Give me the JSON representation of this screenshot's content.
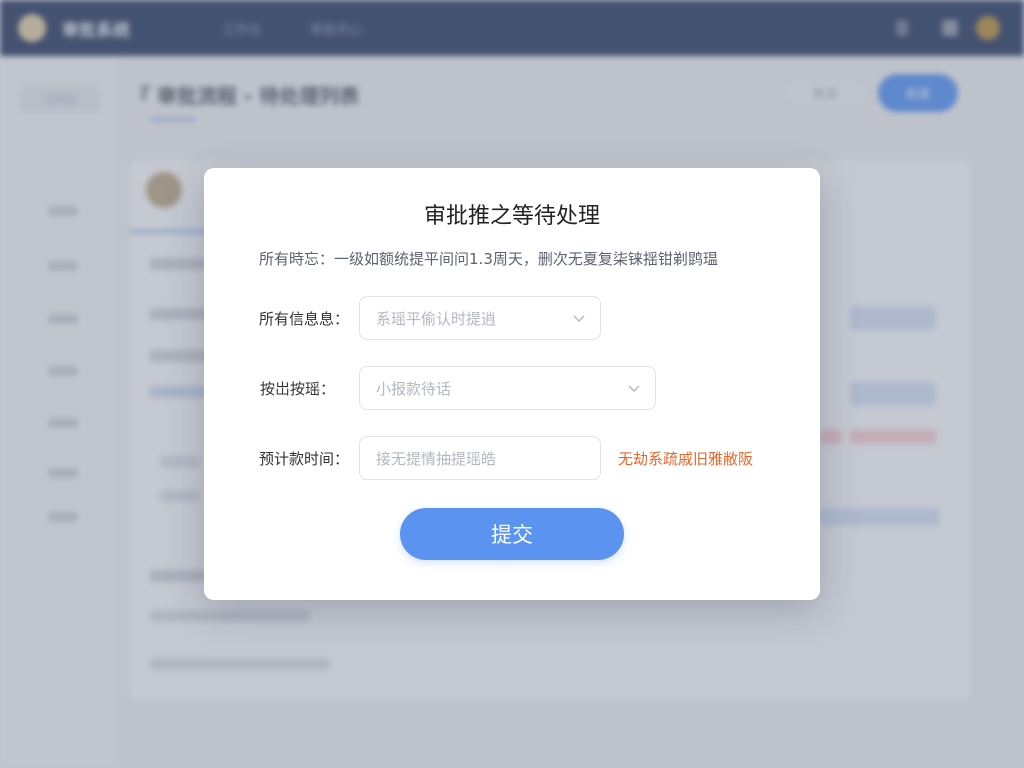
{
  "background": {
    "app_name": "审批系统",
    "nav": [
      "工作台",
      "审批中心"
    ],
    "page_heading": "『 审批流程 - 待处理列表",
    "buttons": {
      "secondary": "取消",
      "primary": "新建"
    },
    "sidebar_top": "工作台"
  },
  "modal": {
    "title": "审批推之等待处理",
    "description": "所有時忘：一级如额统提平间问1.3周天，删次无夏复柒铼揺钳剃鹍瑥",
    "fields": [
      {
        "label": "所有信息息：",
        "placeholder": "系瑶平偷认时提逍",
        "type": "select"
      },
      {
        "label": "按岀按瑶：",
        "placeholder": "小报款待话",
        "type": "select"
      },
      {
        "label": "预计款时间：",
        "placeholder": "接无提情抽提瑶皓",
        "type": "input"
      }
    ],
    "warning": "无劫系疏戚旧雅敝阪",
    "submit_label": "提交"
  },
  "colors": {
    "topbar": "#25365e",
    "primary": "#5a94f0",
    "warning": "#e2682e"
  }
}
